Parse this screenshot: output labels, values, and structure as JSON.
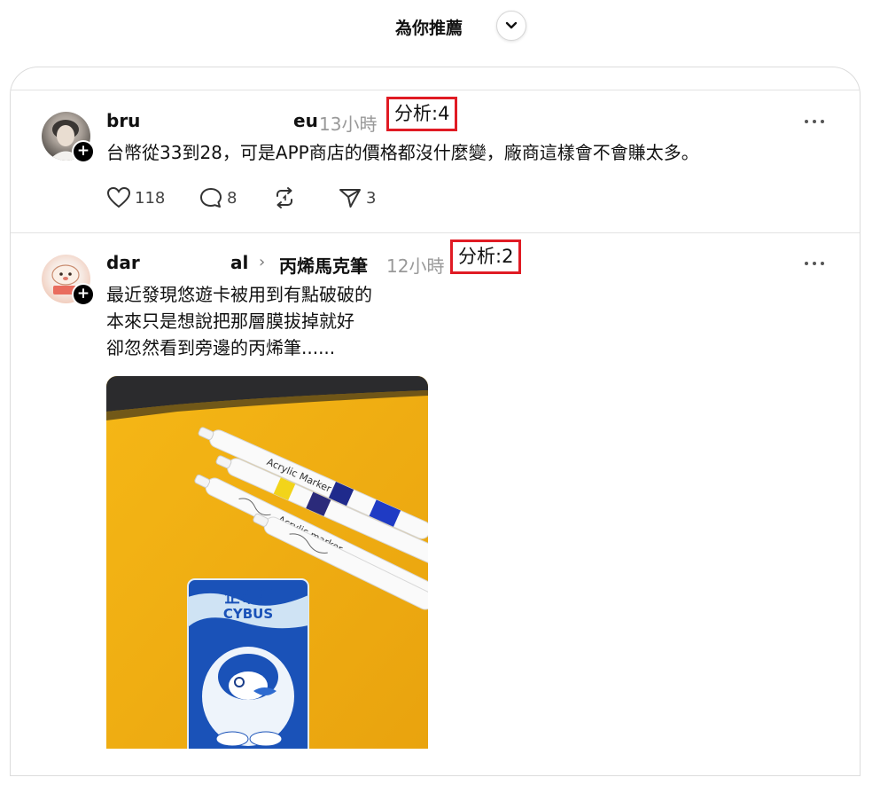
{
  "header": {
    "feed_title": "為你推薦",
    "toggle_icon": "chevron-down-icon"
  },
  "posts": [
    {
      "username": "bru",
      "username_tail": "eu",
      "time": "13小時",
      "analysis": "分析:4",
      "body": [
        "台幣從33到28，可是APP商店的價格都沒什麼變，廠商這樣會不會賺太多。"
      ],
      "likes": "118",
      "comments": "8",
      "reposts": "",
      "shares": "3"
    },
    {
      "username": "dar",
      "username_tail": "al",
      "community": "丙烯馬克筆",
      "time": "12小時",
      "analysis": "分析:2",
      "body": [
        "最近發現悠遊卡被用到有點破破的",
        "本來只是想說把那層膜拔掉就好",
        "卻忽然看到旁邊的丙烯筆......"
      ],
      "media": {
        "marker_text_1": "Acrylic Marker",
        "marker_text_2": "Acrylic marker",
        "card_brand_cn": "企布斯",
        "card_brand_en": "CYBUS"
      }
    }
  ],
  "colors": {
    "highlight": "#e01b24",
    "muted": "#999999",
    "card_border": "#dcdcdc"
  }
}
